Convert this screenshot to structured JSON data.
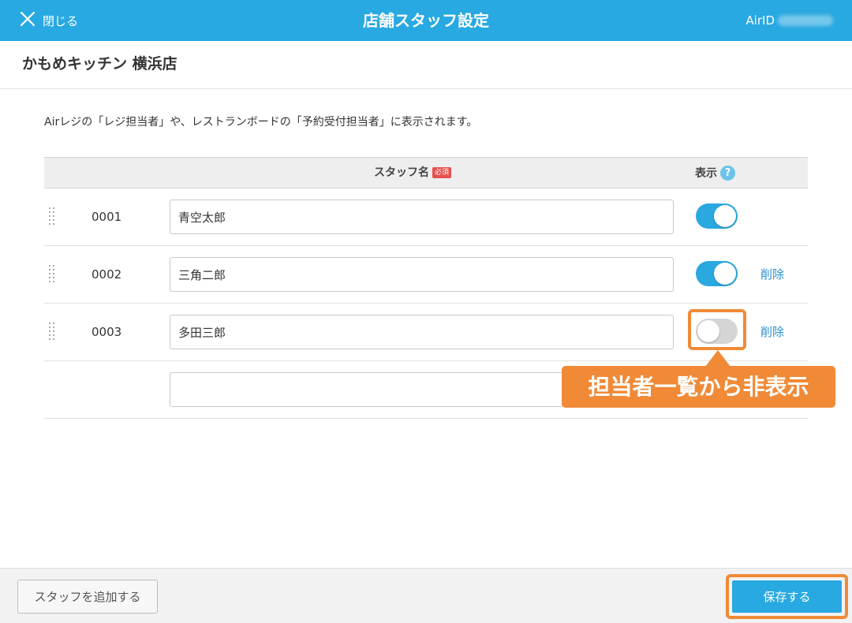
{
  "header": {
    "close_label": "閉じる",
    "title": "店舗スタッフ設定",
    "airid_label": "AirID"
  },
  "store": {
    "name": "かもめキッチン 横浜店"
  },
  "description": "Airレジの「レジ担当者」や、レストランボードの「予約受付担当者」に表示されます。",
  "table": {
    "col_name": "スタッフ名",
    "required_badge": "必須",
    "col_show": "表示",
    "help_glyph": "?",
    "rows": [
      {
        "no": "0001",
        "name": "青空太郎",
        "visible": true,
        "delete_label": ""
      },
      {
        "no": "0002",
        "name": "三角二郎",
        "visible": true,
        "delete_label": "削除"
      },
      {
        "no": "0003",
        "name": "多田三郎",
        "visible": false,
        "delete_label": "削除"
      }
    ],
    "new_row_value": ""
  },
  "callout": {
    "text": "担当者一覧から非表示"
  },
  "footer": {
    "add_label": "スタッフを追加する",
    "save_label": "保存する"
  },
  "colors": {
    "primary": "#29a9e1",
    "accent_orange": "#f08a37",
    "required_red": "#e6504e",
    "link_blue": "#2a8fd1"
  },
  "icons": {
    "close": "close-icon",
    "drag": "drag-handle-icon",
    "help": "help-icon"
  }
}
